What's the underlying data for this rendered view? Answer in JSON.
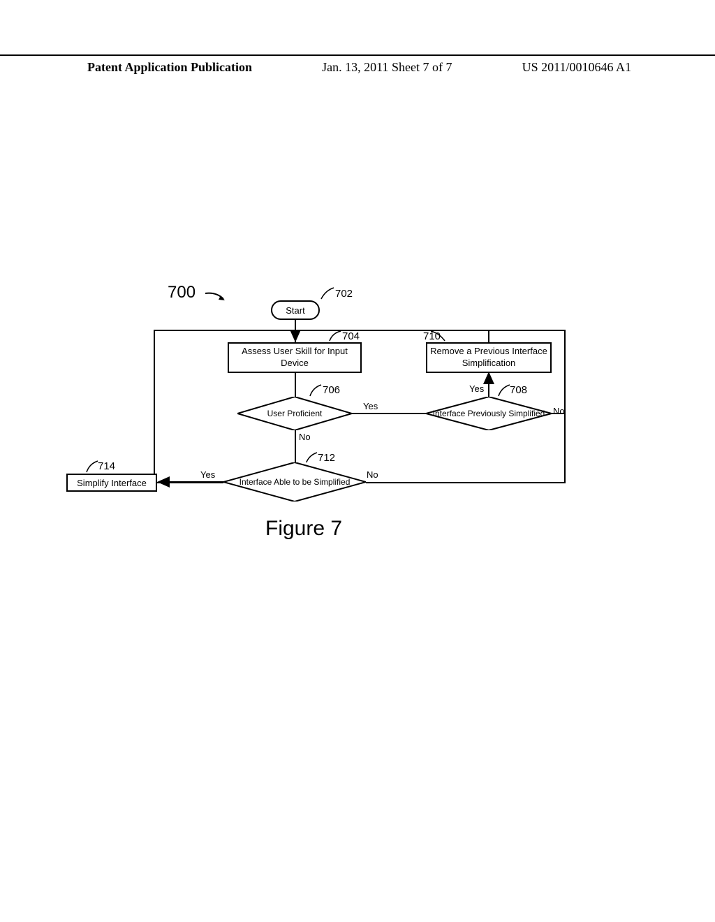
{
  "header": {
    "left": "Patent Application Publication",
    "center": "Jan. 13, 2011  Sheet 7 of 7",
    "right": "US 2011/0010646 A1"
  },
  "diagram": {
    "main_ref": "700",
    "start": {
      "label": "Start",
      "ref": "702"
    },
    "assess": {
      "label": "Assess User Skill for Input Device",
      "ref": "704"
    },
    "remove": {
      "label": "Remove a Previous Interface Simplification",
      "ref": "710"
    },
    "d706": {
      "label": "User Proficient",
      "ref": "706",
      "yes": "Yes",
      "no": "No"
    },
    "d708": {
      "label": "Interface Previously Simplified",
      "ref": "708",
      "yes": "Yes",
      "no": "No"
    },
    "d712": {
      "label": "Interface Able to be Simplified",
      "ref": "712",
      "yes": "Yes",
      "no": "No"
    },
    "simplify": {
      "label": "Simplify Interface",
      "ref": "714"
    },
    "caption": "Figure 7"
  }
}
